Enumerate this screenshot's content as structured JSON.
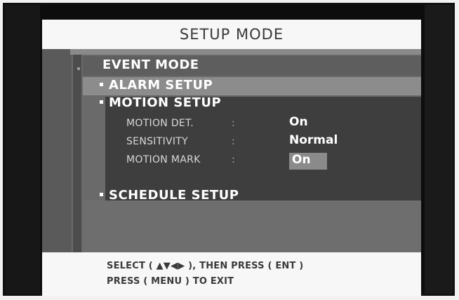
{
  "screen": {
    "title": "SETUP MODE",
    "section_title": "EVENT MODE"
  },
  "menu": {
    "alarm_setup": "ALARM SETUP",
    "motion_setup": "MOTION SETUP",
    "schedule_setup": "SCHEDULE SETUP"
  },
  "motion_settings": [
    {
      "label": "MOTION DET.",
      "value": "On"
    },
    {
      "label": "SENSITIVITY",
      "value": "Normal"
    },
    {
      "label": "MOTION MARK",
      "value": "On",
      "selected": true
    }
  ],
  "footer": {
    "line1": "SELECT ( ▲▼◀▶ ), THEN PRESS ( ENT )",
    "line2": "PRESS ( MENU ) TO EXIT"
  },
  "colors": {
    "header_bg": "#f7f7f7",
    "menu_bg": "#6a6a6a",
    "selected_panel": "#3e3e3e",
    "highlight": "#8a8a8a"
  }
}
